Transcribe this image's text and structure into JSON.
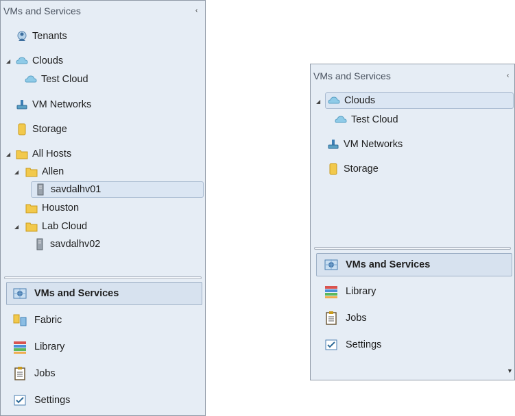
{
  "left": {
    "title": "VMs and Services",
    "tree": {
      "tenants": "Tenants",
      "clouds": "Clouds",
      "test_cloud": "Test Cloud",
      "vm_networks": "VM Networks",
      "storage": "Storage",
      "all_hosts": "All Hosts",
      "allen": "Allen",
      "host1": "savdalhv01",
      "houston": "Houston",
      "lab_cloud": "Lab Cloud",
      "host2": "savdalhv02"
    },
    "workspaces": [
      "VMs and Services",
      "Fabric",
      "Library",
      "Jobs",
      "Settings"
    ]
  },
  "right": {
    "title": "VMs and Services",
    "tree": {
      "clouds": "Clouds",
      "test_cloud": "Test Cloud",
      "vm_networks": "VM Networks",
      "storage": "Storage"
    },
    "workspaces": [
      "VMs and Services",
      "Library",
      "Jobs",
      "Settings"
    ]
  },
  "glyphs": {
    "collapse": "‹",
    "expand_open": "◢",
    "scroll_down": "▼"
  },
  "colors": {
    "panel_bg": "#e6edf5",
    "selection_bg": "#dbe6f3",
    "folder": "#f2c94c",
    "cloud": "#8fcbe8"
  }
}
